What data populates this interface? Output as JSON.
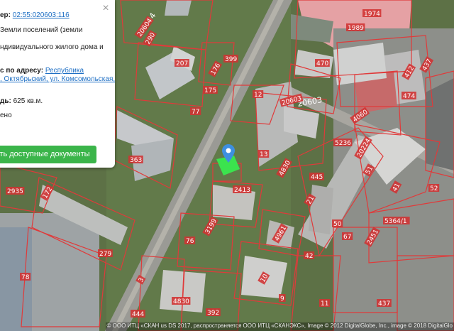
{
  "popup": {
    "cadastral_label": "ер:",
    "cadastral_number": "02:55:020603:116",
    "category_line": "Земли поселений (земли",
    "use_line": "ндивидуального жилого дома и",
    "address_label": "с по адресу:",
    "address_link_1": "Республика",
    "address_link_2": ", Октябрьский, ул. Комсомольская,",
    "area_label": "дь:",
    "area_value": "625 кв.м.",
    "status": "ено",
    "documents_button": "ть доступные документы",
    "close_symbol": "×"
  },
  "attribution": "© ООО ИТЦ «СКАН   us DS 2017, распространяется ООО ИТЦ «СКАНЭКС», Image © 2012 DigitalGlobe, Inc., image © 2018 DigitalGlo",
  "colors": {
    "parcel_outline": "#e03a3a",
    "selected_parcel": "#3be34e",
    "pin": "#3d8fe0",
    "button": "#3bb54a",
    "link": "#1e6fc4"
  },
  "quarter_labels": [
    "20604",
    "20603"
  ],
  "parcel_numbers": [
    "1974",
    "1989",
    "470",
    "20604",
    "290",
    "207",
    "399",
    "176",
    "175",
    "77",
    "12",
    "13",
    "20603",
    "5236",
    "4060",
    "20224",
    "51",
    "41",
    "412",
    "474",
    "437",
    "52",
    "2451",
    "5364/1",
    "445",
    "4830",
    "363",
    "2935",
    "172",
    "279",
    "78",
    "76",
    "3199",
    "4961",
    "2413",
    "50",
    "42",
    "10",
    "9",
    "67",
    "11",
    "437",
    "444",
    "4830",
    "392",
    "3",
    "21",
    "425",
    "1084"
  ],
  "map_icons": [
    "location-pin-icon"
  ]
}
